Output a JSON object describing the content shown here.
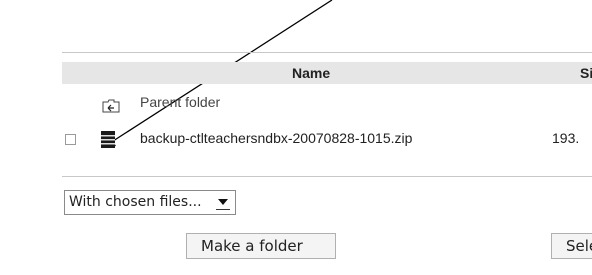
{
  "table": {
    "columns": {
      "name": "Name",
      "size": "Si:"
    },
    "parent_folder": {
      "label": "Parent folder",
      "icon": "parent-folder-icon"
    },
    "files": [
      {
        "name": "backup-ctlteachersndbx-20070828-1015.zip",
        "size": "193.",
        "icon": "zip-file-icon",
        "checked": false
      }
    ]
  },
  "actions": {
    "chosen_files_select": {
      "selected": "With chosen files...",
      "icon": "dropdown-arrow-icon"
    },
    "make_folder_label": "Make a folder",
    "select_label": "Sele"
  },
  "annotation": {
    "icon": "pointer-arrow-icon"
  }
}
